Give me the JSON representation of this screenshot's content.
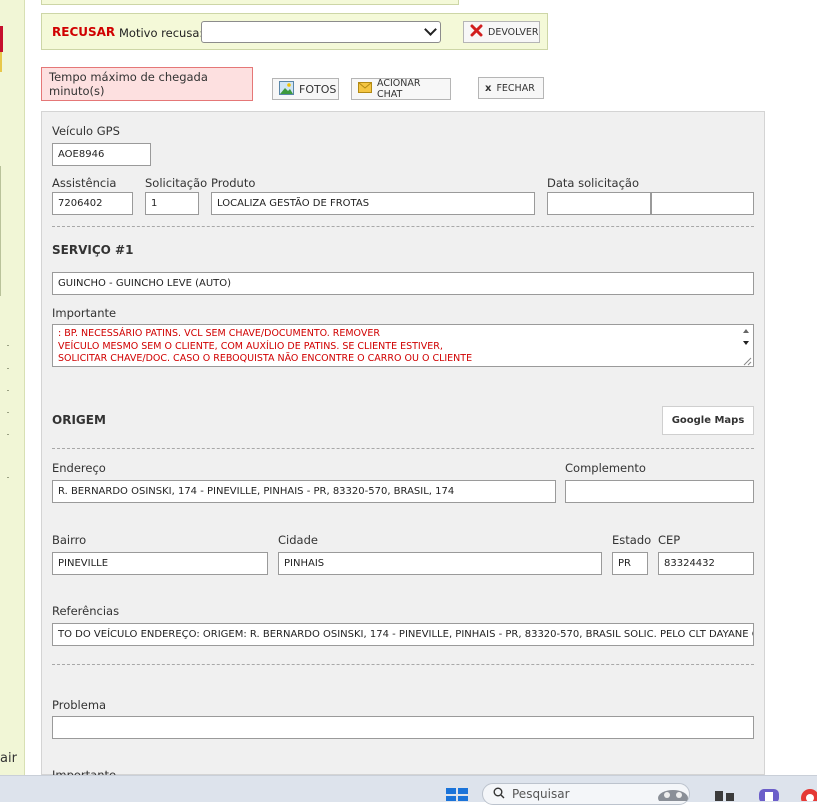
{
  "left_panel": {
    "partial_text": "air"
  },
  "recusa": {
    "recusar_label": "RECUSAR",
    "motivo_label": "Motivo recusa:",
    "motivo_value": "",
    "devolver_label": "DEVOLVER"
  },
  "alert": {
    "tempo_label": "Tempo máximo de chegada minuto(s)"
  },
  "toolbar": {
    "fotos_label": "FOTOS",
    "chat_label": "ACIONAR CHAT",
    "fechar_label": "FECHAR"
  },
  "form": {
    "veiculo_gps": {
      "label": "Veículo GPS",
      "value": "AOE8946"
    },
    "assistencia": {
      "label": "Assistência",
      "value": "7206402"
    },
    "solicitacao": {
      "label": "Solicitação",
      "value": "1"
    },
    "produto": {
      "label": "Produto",
      "value": "LOCALIZA GESTÃO DE FROTAS"
    },
    "data_solicitacao": {
      "label": "Data solicitação",
      "value1": "",
      "value2": ""
    }
  },
  "servico": {
    "title": "SERVIÇO #1",
    "tipo_value": "GUINCHO - GUINCHO LEVE (AUTO)",
    "importante_label": "Importante",
    "importante_lines": [
      ": BP. NECESSÁRIO PATINS. VCL SEM CHAVE/DOCUMENTO. REMOVER",
      "VEÍCULO MESMO SEM O CLIENTE, COM AUXÍLIO DE PATINS. SE CLIENTE ESTIVER,",
      "SOLICITAR CHAVE/DOC. CASO O REBOQUISTA NÃO ENCONTRE O CARRO OU O CLIENTE"
    ]
  },
  "origem": {
    "title": "ORIGEM",
    "google_maps_label": "Google Maps",
    "endereco": {
      "label": "Endereço",
      "value": "R. BERNARDO OSINSKI, 174 - PINEVILLE, PINHAIS - PR, 83320-570, BRASIL, 174"
    },
    "complemento": {
      "label": "Complemento",
      "value": ""
    },
    "bairro": {
      "label": "Bairro",
      "value": "PINEVILLE"
    },
    "cidade": {
      "label": "Cidade",
      "value": "PINHAIS"
    },
    "estado": {
      "label": "Estado",
      "value": "PR"
    },
    "cep": {
      "label": "CEP",
      "value": "83324432"
    },
    "referencias": {
      "label": "Referências",
      "value": "TO DO VEÍCULO ENDEREÇO: ORIGEM: R. BERNARDO OSINSKI, 174 - PINEVILLE, PINHAIS - PR, 83320-570, BRASIL SOLIC. PELO CLT DAYANE C"
    }
  },
  "problema": {
    "label": "Problema",
    "value": ""
  },
  "next_label_partial": "Importante",
  "taskbar": {
    "search_placeholder": "Pesquisar"
  },
  "colors": {
    "accent_red": "#d00000",
    "panel_bg": "#f0f0f0",
    "bar_bg": "#f4f9d8"
  }
}
